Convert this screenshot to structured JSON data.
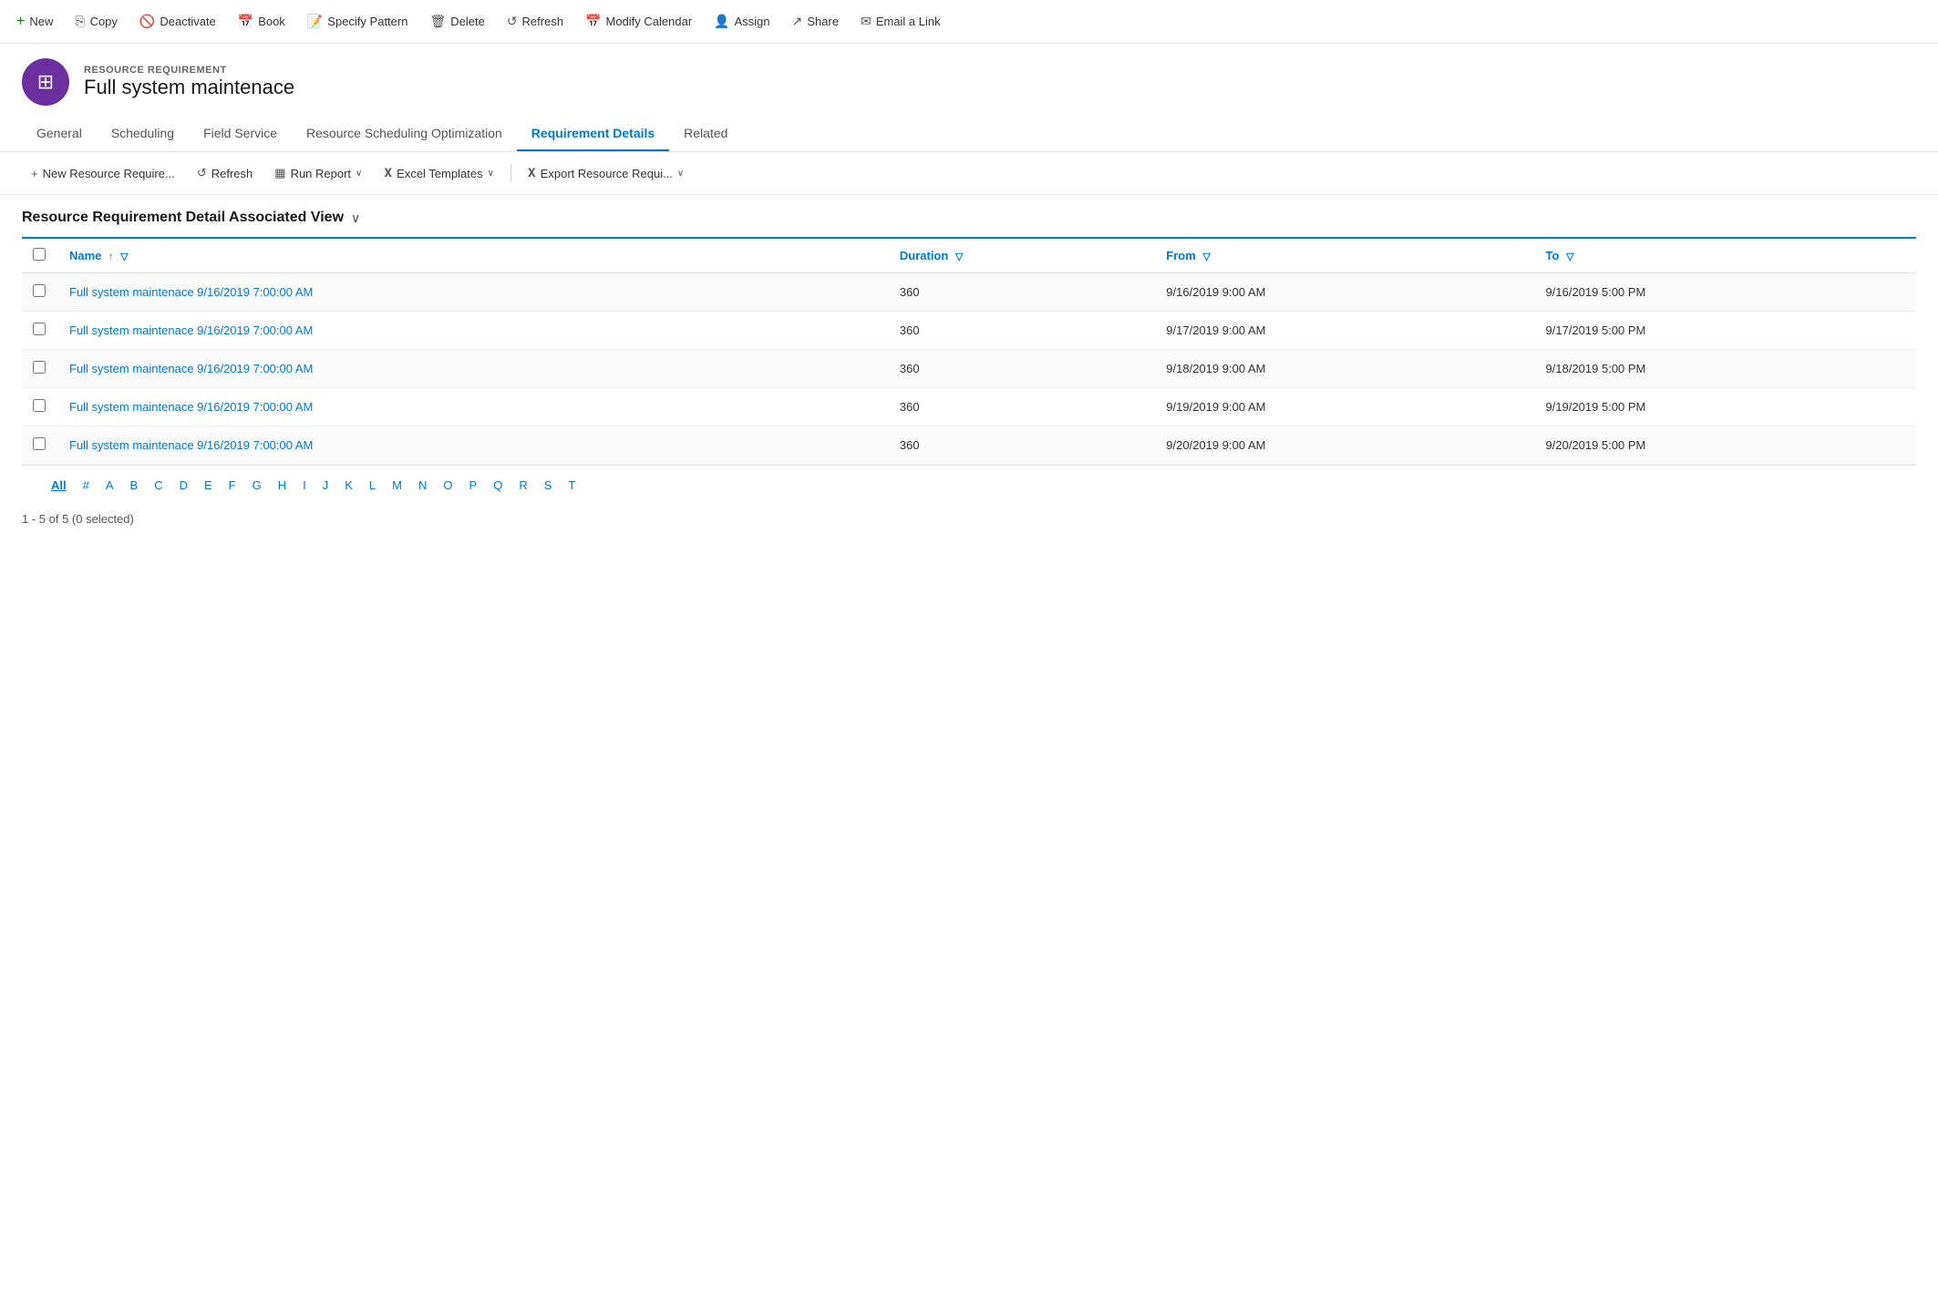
{
  "toolbar": {
    "buttons": [
      {
        "id": "new",
        "label": "New",
        "icon": "+"
      },
      {
        "id": "copy",
        "label": "Copy",
        "icon": "📋"
      },
      {
        "id": "deactivate",
        "label": "Deactivate",
        "icon": "🚫"
      },
      {
        "id": "book",
        "label": "Book",
        "icon": "📅"
      },
      {
        "id": "specify-pattern",
        "label": "Specify Pattern",
        "icon": "📝"
      },
      {
        "id": "delete",
        "label": "Delete",
        "icon": "🗑"
      },
      {
        "id": "refresh",
        "label": "Refresh",
        "icon": "↺"
      },
      {
        "id": "modify-calendar",
        "label": "Modify Calendar",
        "icon": "📅"
      },
      {
        "id": "assign",
        "label": "Assign",
        "icon": "👤"
      },
      {
        "id": "share",
        "label": "Share",
        "icon": "↗"
      },
      {
        "id": "email-link",
        "label": "Email a Link",
        "icon": "✉"
      }
    ]
  },
  "record": {
    "type": "RESOURCE REQUIREMENT",
    "name": "Full system maintenace",
    "avatar_icon": "⊞"
  },
  "tabs": [
    {
      "id": "general",
      "label": "General",
      "active": false
    },
    {
      "id": "scheduling",
      "label": "Scheduling",
      "active": false
    },
    {
      "id": "field-service",
      "label": "Field Service",
      "active": false
    },
    {
      "id": "resource-scheduling-optimization",
      "label": "Resource Scheduling Optimization",
      "active": false
    },
    {
      "id": "requirement-details",
      "label": "Requirement Details",
      "active": true
    },
    {
      "id": "related",
      "label": "Related",
      "active": false
    }
  ],
  "sub_toolbar": {
    "buttons": [
      {
        "id": "new-resource-require",
        "label": "New Resource Require...",
        "icon": "+"
      },
      {
        "id": "refresh",
        "label": "Refresh",
        "icon": "↺"
      },
      {
        "id": "run-report",
        "label": "Run Report",
        "icon": "📊",
        "has_chevron": true
      },
      {
        "id": "excel-templates",
        "label": "Excel Templates",
        "icon": "📗",
        "has_chevron": true
      },
      {
        "id": "export-resource-requi",
        "label": "Export Resource Requi...",
        "icon": "📗",
        "has_chevron": true
      }
    ]
  },
  "view": {
    "title": "Resource Requirement Detail Associated View",
    "chevron": "∨"
  },
  "table": {
    "columns": [
      {
        "id": "name",
        "label": "Name",
        "has_sort": true,
        "has_filter": true
      },
      {
        "id": "duration",
        "label": "Duration",
        "has_sort": false,
        "has_filter": true
      },
      {
        "id": "from",
        "label": "From",
        "has_sort": false,
        "has_filter": true
      },
      {
        "id": "to",
        "label": "To",
        "has_sort": false,
        "has_filter": true
      }
    ],
    "rows": [
      {
        "name": "Full system maintenace 9/16/2019 7:00:00 AM",
        "duration": "360",
        "from": "9/16/2019 9:00 AM",
        "to": "9/16/2019 5:00 PM"
      },
      {
        "name": "Full system maintenace 9/16/2019 7:00:00 AM",
        "duration": "360",
        "from": "9/17/2019 9:00 AM",
        "to": "9/17/2019 5:00 PM"
      },
      {
        "name": "Full system maintenace 9/16/2019 7:00:00 AM",
        "duration": "360",
        "from": "9/18/2019 9:00 AM",
        "to": "9/18/2019 5:00 PM"
      },
      {
        "name": "Full system maintenace 9/16/2019 7:00:00 AM",
        "duration": "360",
        "from": "9/19/2019 9:00 AM",
        "to": "9/19/2019 5:00 PM"
      },
      {
        "name": "Full system maintenace 9/16/2019 7:00:00 AM",
        "duration": "360",
        "from": "9/20/2019 9:00 AM",
        "to": "9/20/2019 5:00 PM"
      }
    ]
  },
  "pagination": {
    "letters": [
      "All",
      "#",
      "A",
      "B",
      "C",
      "D",
      "E",
      "F",
      "G",
      "H",
      "I",
      "J",
      "K",
      "L",
      "M",
      "N",
      "O",
      "P",
      "Q",
      "R",
      "S",
      "T"
    ],
    "active": "All"
  },
  "record_count": "1 - 5 of 5 (0 selected)"
}
